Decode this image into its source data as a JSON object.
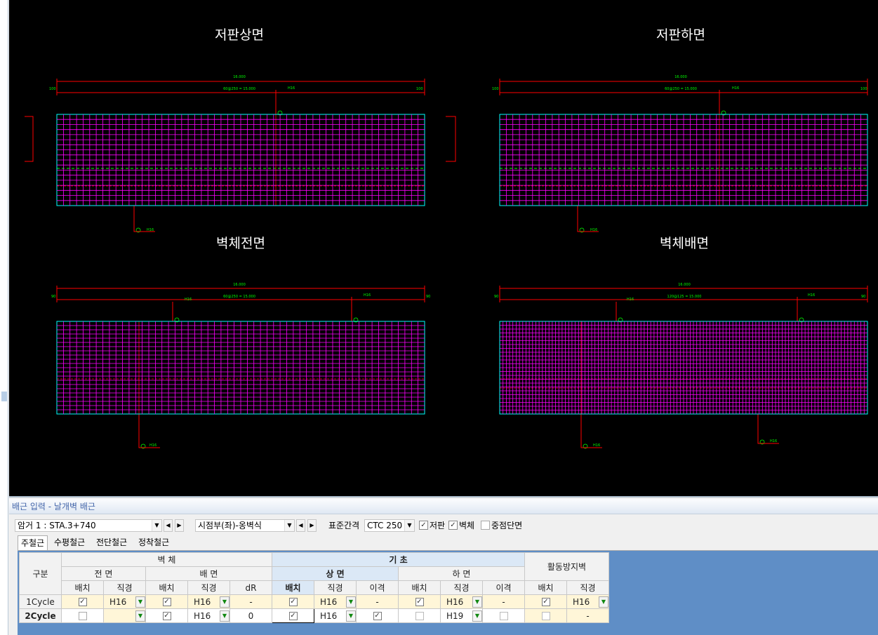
{
  "drawing": {
    "panels": [
      {
        "title": "저판상면",
        "dims": {
          "total": "16.000",
          "mid": "60@250 = 15.000",
          "left": "100",
          "right": "100",
          "callout_top": "H16",
          "callout_bottom": "H16"
        }
      },
      {
        "title": "저판하면",
        "dims": {
          "total": "16.000",
          "mid": "60@250 = 15.000",
          "left": "100",
          "right": "100",
          "callout_top": "H16",
          "callout_bottom": "H16"
        }
      },
      {
        "title": "벽체전면",
        "dims": {
          "total": "16.000",
          "mid": "60@250 = 15.000",
          "left": "90",
          "right": "90",
          "callout_top1": "H16",
          "callout_top2": "H16",
          "callout_bottom": "H16"
        }
      },
      {
        "title": "벽체배면",
        "dims": {
          "total": "16.000",
          "mid": "120@125 = 15.000",
          "left": "90",
          "right": "90",
          "callout_top1": "H16",
          "callout_top2": "H16",
          "callout_bottom1": "H16",
          "callout_bottom2": "H16"
        }
      }
    ]
  },
  "panel": {
    "header": "배근 입력 - 날개벽 배근",
    "combo_station": "암거 1 : STA.3+740",
    "combo_part": "시점부(좌)-옹벽식",
    "std_spacing_label": "표준간격",
    "std_spacing_value": "CTC 250",
    "chk_slab": "저판",
    "chk_wall": "벽체",
    "chk_overlap": "중점단면",
    "tabs": [
      "주철근",
      "수평철근",
      "전단철근",
      "정착철근"
    ]
  },
  "grid": {
    "h_group": "구분",
    "h_wall": "벽 체",
    "h_foundation": "기 초",
    "h_slip": "활동방지벽",
    "h_front": "전 면",
    "h_back": "배 면",
    "h_top": "상 면",
    "h_bottom": "하 면",
    "h_place": "배치",
    "h_dia": "직경",
    "h_dr": "dR",
    "h_gap": "이격",
    "rows": [
      {
        "name": "1Cycle",
        "wall_front_dia": "H16",
        "wall_back_dia": "H16",
        "dr": "-",
        "top_dia": "H16",
        "top_gap": "-",
        "bot_dia": "H16",
        "bot_gap": "-",
        "slip_dia": "H16"
      },
      {
        "name": "2Cycle",
        "wall_front_dia": "",
        "wall_back_dia": "H16",
        "dr": "0",
        "top_dia": "H16",
        "top_gap": "",
        "bot_dia": "H19",
        "bot_gap": "",
        "slip_dia": "-"
      }
    ]
  },
  "colors": {
    "rebar": "#ff00ff",
    "outline": "#00ffff",
    "dimension": "#ff0000",
    "text_green": "#00ff00"
  }
}
